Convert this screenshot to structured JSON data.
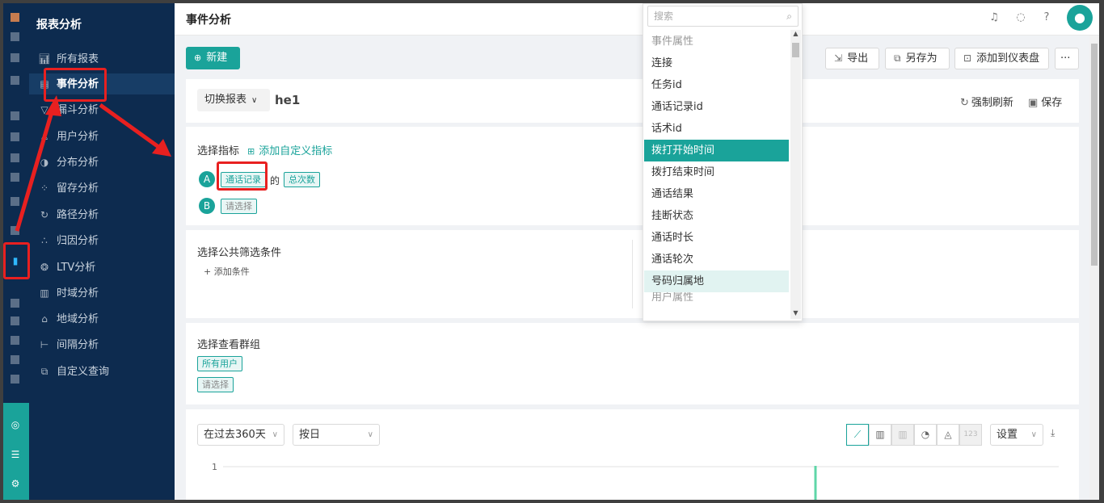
{
  "rail": {
    "icons": [
      "grid-icon",
      "chart-bar-icon",
      "target-icon",
      "server-icon",
      "gear-icon"
    ]
  },
  "sidebar": {
    "title": "报表分析",
    "items": [
      {
        "label": "所有报表",
        "icon": "bar-chart-icon"
      },
      {
        "label": "事件分析",
        "icon": "document-icon"
      },
      {
        "label": "漏斗分析",
        "icon": "funnel-icon"
      },
      {
        "label": "用户分析",
        "icon": "user-icon"
      },
      {
        "label": "分布分析",
        "icon": "distribution-icon"
      },
      {
        "label": "留存分析",
        "icon": "dots-icon"
      },
      {
        "label": "路径分析",
        "icon": "path-icon"
      },
      {
        "label": "归因分析",
        "icon": "attribution-icon"
      },
      {
        "label": "LTV分析",
        "icon": "ltv-icon"
      },
      {
        "label": "时域分析",
        "icon": "time-chart-icon"
      },
      {
        "label": "地域分析",
        "icon": "location-icon"
      },
      {
        "label": "间隔分析",
        "icon": "interval-icon"
      },
      {
        "label": "自定义查询",
        "icon": "query-icon"
      }
    ]
  },
  "header": {
    "page_title": "事件分析"
  },
  "toolbar": {
    "new_label": "新建",
    "export_label": "导出",
    "save_as_label": "另存为",
    "add_dashboard_label": "添加到仪表盘",
    "more_label": "···"
  },
  "report": {
    "switch_label": "切换报表",
    "name": "he1",
    "refresh_label": "强制刷新",
    "save_label": "保存"
  },
  "metrics": {
    "title": "选择指标",
    "add_custom": "添加自定义指标",
    "a_badge": "A",
    "a_event": "通话记录",
    "a_of": "的",
    "a_measure": "总次数",
    "b_badge": "B",
    "b_placeholder": "请选择"
  },
  "filters": {
    "title": "选择公共筛选条件",
    "add_condition": "+ 添加条件"
  },
  "groups": {
    "title": "选择查看群组",
    "all_users": "所有用户",
    "placeholder": "请选择"
  },
  "chart_controls": {
    "range": "在过去360天",
    "granularity": "按日",
    "settings": "设置",
    "ctype_123": "123"
  },
  "chart_data": {
    "type": "line",
    "y_ticks": [
      "1"
    ],
    "ylim": [
      0,
      1
    ]
  },
  "dropdown": {
    "search_placeholder": "搜索",
    "rows": [
      {
        "label": "事件属性",
        "kind": "group"
      },
      {
        "label": "连接",
        "kind": "item"
      },
      {
        "label": "任务id",
        "kind": "item"
      },
      {
        "label": "通话记录id",
        "kind": "item"
      },
      {
        "label": "话术id",
        "kind": "item"
      },
      {
        "label": "拨打开始时间",
        "kind": "selected"
      },
      {
        "label": "拨打结束时间",
        "kind": "item"
      },
      {
        "label": "通话结果",
        "kind": "item"
      },
      {
        "label": "挂断状态",
        "kind": "item"
      },
      {
        "label": "通话时长",
        "kind": "item"
      },
      {
        "label": "通话轮次",
        "kind": "item"
      },
      {
        "label": "号码归属地",
        "kind": "hover"
      },
      {
        "label": "用户属性",
        "kind": "group"
      }
    ]
  },
  "colors": {
    "accent": "#1aa39a",
    "sidebar_bg": "#0d2b4f",
    "annotation": "#e82020"
  }
}
